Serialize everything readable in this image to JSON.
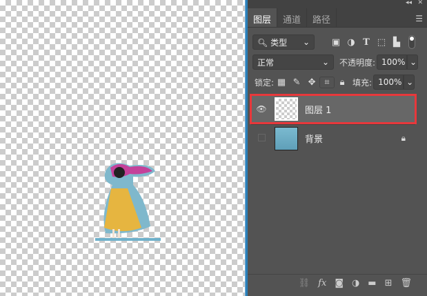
{
  "tabs": [
    "图层",
    "通道",
    "路径"
  ],
  "filter": {
    "label": "类型"
  },
  "blend_mode": "正常",
  "opacity": {
    "label": "不透明度:",
    "value": "100%"
  },
  "lock": {
    "label": "锁定:"
  },
  "fill": {
    "label": "填充:",
    "value": "100%"
  },
  "layers": [
    {
      "name": "图层 1",
      "visible": true,
      "selected": true
    },
    {
      "name": "背景",
      "visible": false,
      "locked": true
    }
  ],
  "highlight_color": "#e8383b"
}
